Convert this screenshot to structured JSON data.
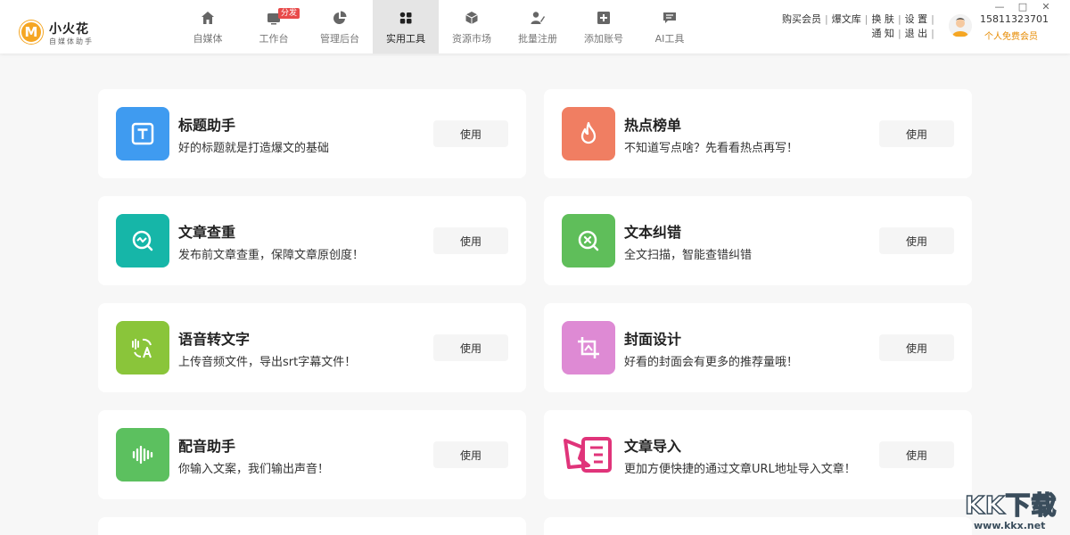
{
  "app": {
    "logo_letter": "M",
    "title": "小火花",
    "subtitle": "自媒体助手"
  },
  "nav": [
    {
      "label": "自媒体",
      "icon": "home-icon",
      "badge": null
    },
    {
      "label": "工作台",
      "icon": "workbench-icon",
      "badge": "分发"
    },
    {
      "label": "管理后台",
      "icon": "pie-chart-icon",
      "badge": null
    },
    {
      "label": "实用工具",
      "icon": "grid-icon",
      "badge": null,
      "active": true
    },
    {
      "label": "资源市场",
      "icon": "cube-icon",
      "badge": null
    },
    {
      "label": "批量注册",
      "icon": "user-edit-icon",
      "badge": null
    },
    {
      "label": "添加账号",
      "icon": "plus-box-icon",
      "badge": null
    },
    {
      "label": "AI工具",
      "icon": "chat-icon",
      "badge": null
    }
  ],
  "user": {
    "links_row1": [
      "购买会员",
      "爆文库",
      "换 肤",
      "设 置"
    ],
    "links_row2": [
      "通 知",
      "退 出"
    ],
    "phone": "15811323701",
    "membership": "个人免费会员"
  },
  "window": {
    "minimize": "—",
    "maximize": "□",
    "close": "✕"
  },
  "tools": [
    {
      "title": "标题助手",
      "desc": "好的标题就是打造爆文的基础",
      "button": "使用",
      "icon": "title-icon",
      "color": "#3f9bf0"
    },
    {
      "title": "热点榜单",
      "desc": "不知道写点啥？先看看热点再写！",
      "button": "使用",
      "icon": "fire-icon",
      "color": "#f07e62"
    },
    {
      "title": "文章查重",
      "desc": "发布前文章查重，保障文章原创度！",
      "button": "使用",
      "icon": "search-check-icon",
      "color": "#16b6a8"
    },
    {
      "title": "文本纠错",
      "desc": "全文扫描，智能查错纠错",
      "button": "使用",
      "icon": "error-search-icon",
      "color": "#5fbe5a"
    },
    {
      "title": "语音转文字",
      "desc": "上传音频文件，导出srt字幕文件！",
      "button": "使用",
      "icon": "voice-to-text-icon",
      "color": "#8ac53a"
    },
    {
      "title": "封面设计",
      "desc": "好看的封面会有更多的推荐量哦！",
      "button": "使用",
      "icon": "crop-icon",
      "color": "#de8ad4"
    },
    {
      "title": "配音助手",
      "desc": "你输入文案，我们输出声音！",
      "button": "使用",
      "icon": "waveform-icon",
      "color": "#5cc05f"
    },
    {
      "title": "文章导入",
      "desc": "更加方便快捷的通过文章URL地址导入文章！",
      "button": "使用",
      "icon": "import-icon",
      "color": "#e0347a"
    }
  ],
  "watermark": {
    "big": "KK下载",
    "small": "www.kkx.net"
  }
}
